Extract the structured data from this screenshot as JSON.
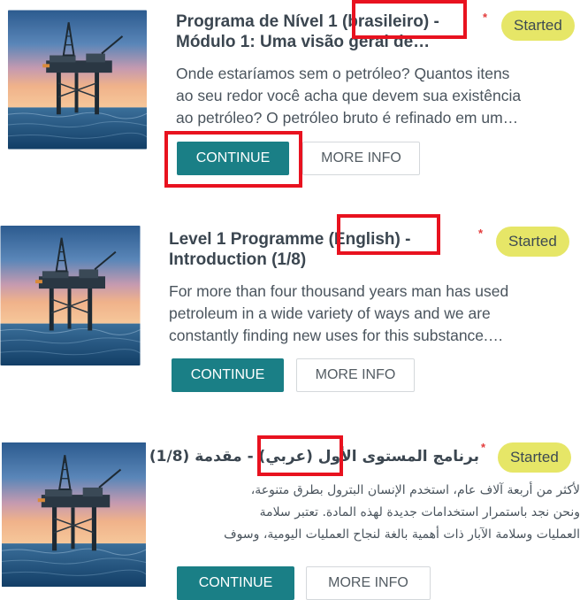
{
  "courses": [
    {
      "title_line1": "Programa de Nível 1 (brasileiro) -",
      "title_line2": "Módulo 1: Uma visão geral de…",
      "asterisk": "*",
      "status": "Started",
      "description_lines": [
        "Onde estaríamos sem o petróleo? Quantos itens",
        "ao seu redor você acha que devem sua existência",
        "ao petróleo? O petróleo bruto é refinado em um…"
      ],
      "continue_label": "CONTINUE",
      "more_info_label": "MORE INFO"
    },
    {
      "title_line1": "Level 1 Programme (English) -",
      "title_line2": "Introduction (1/8)",
      "asterisk": "*",
      "status": "Started",
      "description_lines": [
        "For more than four thousand years man has used",
        "petroleum in a wide variety of ways and we are",
        "constantly finding new uses for this substance.…"
      ],
      "continue_label": "CONTINUE",
      "more_info_label": "MORE INFO"
    },
    {
      "title_line1": "برنامج المستوى الأول (عربي) - مقدمة (1/8)",
      "asterisk": "*",
      "status": "Started",
      "description_lines": [
        "لأكثر من أربعة آلاف عام، استخدم الإنسان البترول بطرق متنوعة،",
        "ونحن نجد باستمرار استخدامات جديدة لهذه المادة. تعتبر سلامة",
        "العمليات وسلامة الآبار ذات أهمية بالغة لنجاح العمليات اليومية، وسوف"
      ],
      "continue_label": "CONTINUE",
      "more_info_label": "MORE INFO"
    }
  ],
  "colors": {
    "accent": "#1a7f86",
    "badge": "#e6e667",
    "highlight": "#e8121f",
    "required": "#e33b3b"
  },
  "icons": {
    "thumbnail": "offshore-oil-rig-image"
  }
}
